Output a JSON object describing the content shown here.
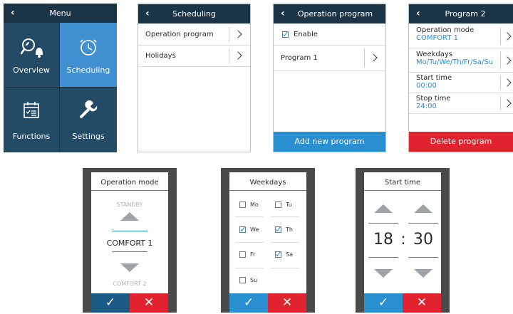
{
  "menu": {
    "title": "Menu",
    "back": "‹",
    "tiles": [
      {
        "label": "Overview",
        "icon": "overview-icon"
      },
      {
        "label": "Scheduling",
        "icon": "clock-icon"
      },
      {
        "label": "Functions",
        "icon": "calendar-list-icon"
      },
      {
        "label": "Settings",
        "icon": "wrench-icon"
      }
    ],
    "colors": {
      "header": "#1b3547",
      "tile_dark": "#244b66",
      "tile_active": "#3f8fd1"
    }
  },
  "scheduling": {
    "title": "Scheduling",
    "back": "‹",
    "items": [
      {
        "label": "Operation program"
      },
      {
        "label": "Holidays"
      }
    ]
  },
  "operation_program": {
    "title": "Operation program",
    "back": "‹",
    "enable_label": "Enable",
    "enable_checked": true,
    "programs": [
      {
        "label": "Program 1"
      }
    ],
    "add_button": "Add new program",
    "colors": {
      "add_button": "#2a8fd0"
    }
  },
  "program2": {
    "title": "Program 2",
    "back": "‹",
    "fields": [
      {
        "label": "Operation mode",
        "value": "COMFORT 1"
      },
      {
        "label": "Weekdays",
        "value": "Mo/Tu/We/Th/Fr/Sa/Su"
      },
      {
        "label": "Start time",
        "value": "00:00"
      },
      {
        "label": "Stop time",
        "value": "24:00"
      }
    ],
    "delete_button": "Delete program",
    "colors": {
      "delete_button": "#e0232f",
      "value_text": "#2a8fd0"
    }
  },
  "operation_mode_dialog": {
    "title": "Operation mode",
    "prev_option": "STANDBY",
    "selected_option": "COMFORT 1",
    "next_option": "COMFORT 2"
  },
  "weekdays_dialog": {
    "title": "Weekdays",
    "days": [
      {
        "label": "Mo",
        "checked": false
      },
      {
        "label": "Tu",
        "checked": false
      },
      {
        "label": "We",
        "checked": true
      },
      {
        "label": "Th",
        "checked": true
      },
      {
        "label": "Fr",
        "checked": false
      },
      {
        "label": "Sa",
        "checked": true
      },
      {
        "label": "Su",
        "checked": false
      }
    ]
  },
  "start_time_dialog": {
    "title": "Start time",
    "hours": "18",
    "separator": ":",
    "minutes": "30"
  },
  "dialog_buttons": {
    "ok_icon": "check-icon",
    "cancel_icon": "x-icon",
    "ok_glyph": "✓",
    "cancel_glyph": "✕"
  }
}
